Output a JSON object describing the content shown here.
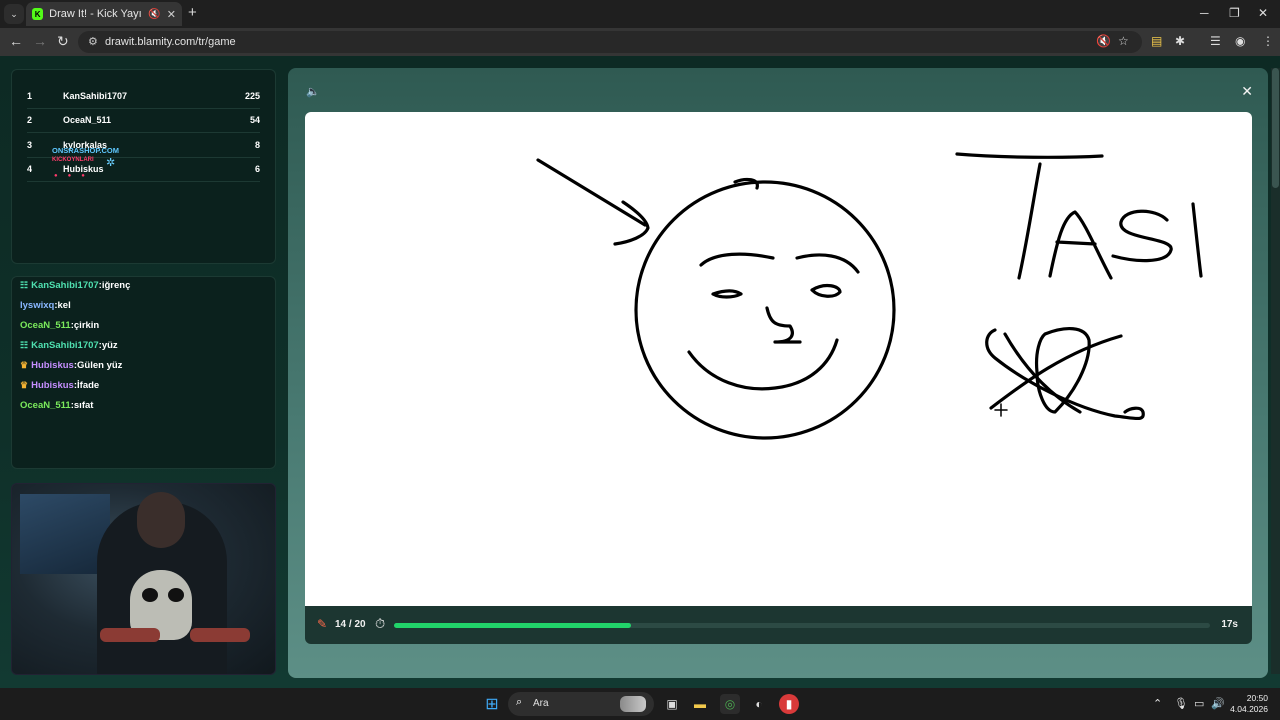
{
  "browser": {
    "tab_title": "Draw It! - Kick Yayınları İçin",
    "url": "drawit.blamity.com/tr/game",
    "new_tab_symbol": "+"
  },
  "leaderboard": [
    {
      "rank": "1",
      "name": "KanSahibi1707",
      "score": "225"
    },
    {
      "rank": "2",
      "name": "OceaN_511",
      "score": "54"
    },
    {
      "rank": "3",
      "name": "kylorkalas",
      "score": "8"
    },
    {
      "rank": "4",
      "name": "Hubiskus",
      "score": "6"
    }
  ],
  "promo": {
    "text": "ONSRASHOP.COM",
    "sub": "KICKOYNLARI"
  },
  "chat": [
    {
      "user": "KanSahibi1707",
      "text": "iğrenç",
      "badge": "☷",
      "color": "teal"
    },
    {
      "user": "lyswixq",
      "text": "kel",
      "badge": "",
      "color": "blue"
    },
    {
      "user": "OceaN_511",
      "text": "çirkin",
      "badge": "",
      "color": "green"
    },
    {
      "user": "KanSahibi1707",
      "text": "yüz",
      "badge": "☷",
      "color": "teal"
    },
    {
      "user": "Hubiskus",
      "text": "Gülen yüz",
      "badge": "♛",
      "color": "purple"
    },
    {
      "user": "Hubiskus",
      "text": "İfade",
      "badge": "♛",
      "color": "purple"
    },
    {
      "user": "OceaN_511",
      "text": "sıfat",
      "badge": "",
      "color": "green"
    }
  ],
  "game": {
    "round": "14 / 20",
    "time_left": "17s",
    "progress": 0.29
  },
  "canvas_word": "TASI",
  "taskbar": {
    "search_placeholder": "Ara",
    "time": "20:50",
    "date": "4.04.2026"
  },
  "colors": {
    "accent_green": "#21d46a",
    "kick_green": "#53fc18",
    "panel_bg": "#0b211d"
  }
}
